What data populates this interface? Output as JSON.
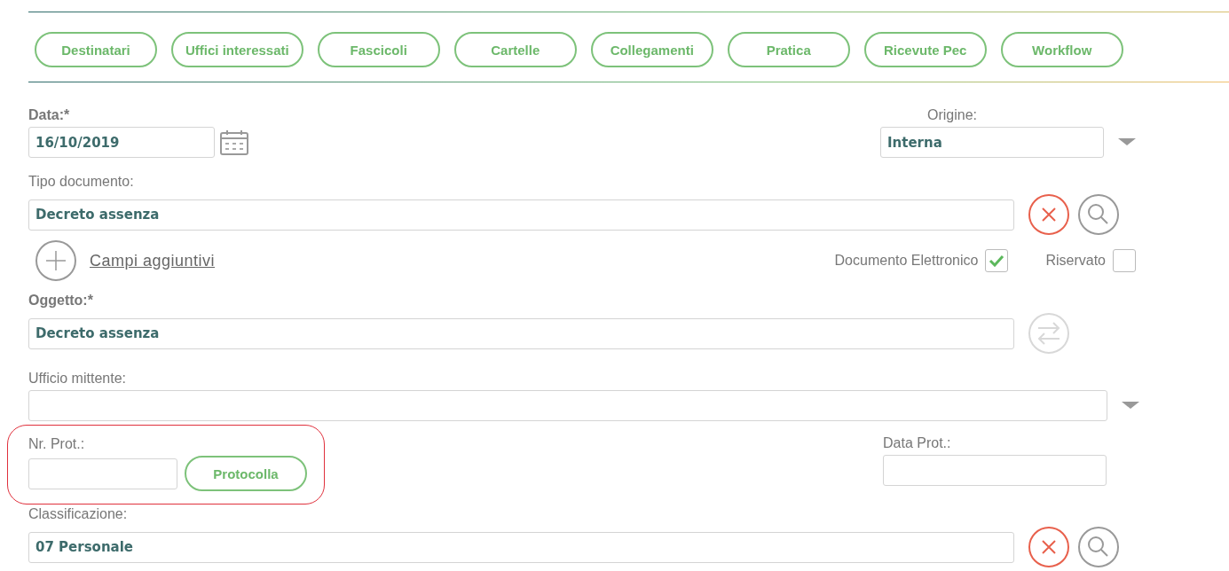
{
  "section_buttons": [
    "Destinatari",
    "Uffici interessati",
    "Fascicoli",
    "Cartelle",
    "Collegamenti",
    "Pratica",
    "Ricevute Pec",
    "Workflow"
  ],
  "data": {
    "label": "Data:*",
    "value": "16/10/2019"
  },
  "origine": {
    "label": "Origine:",
    "value": "Interna"
  },
  "tipo_documento": {
    "label": "Tipo documento:",
    "value": "Decreto assenza"
  },
  "campi_aggiuntivi": "Campi aggiuntivi",
  "checkboxes": [
    {
      "label": "Documento Elettronico",
      "checked": true
    },
    {
      "label": "Riservato",
      "checked": false
    }
  ],
  "oggetto": {
    "label": "Oggetto:*",
    "value": "Decreto assenza",
    "swap_disabled": true
  },
  "ufficio_mittente": {
    "label": "Ufficio mittente:"
  },
  "nr_prot": {
    "label": "Nr. Prot.:",
    "button": "Protocolla",
    "highlighted": true
  },
  "data_prot": {
    "label": "Data Prot.:"
  },
  "classificazione": {
    "label": "Classificazione:",
    "value": "07 Personale"
  }
}
